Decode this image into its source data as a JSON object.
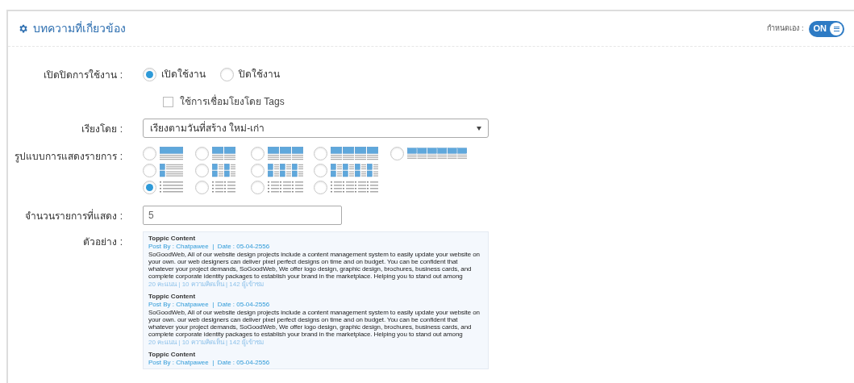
{
  "panel": {
    "title": "บทความที่เกี่ยวข้อง",
    "custom_label": "กำหนดเอง :",
    "custom_toggle": {
      "label": "ON",
      "on": true
    }
  },
  "form": {
    "enable": {
      "label": "เปิดปิดการใช้งาน :",
      "options": [
        {
          "label": "เปิดใช้งาน",
          "selected": true
        },
        {
          "label": "ปิดใช้งาน",
          "selected": false
        }
      ]
    },
    "tags_checkbox": {
      "label": "ใช้การเชื่อมโยงโดย Tags",
      "checked": false
    },
    "sort": {
      "label": "เรียงโดย :",
      "value": "เรียงตามวันที่สร้าง ใหม่-เก่า"
    },
    "layout": {
      "label": "รูปแบบการแสดงรายการ :",
      "rows": [
        [
          {
            "kind": "top",
            "selected": false
          },
          {
            "kind": "top",
            "selected": false
          },
          {
            "kind": "top",
            "selected": false
          },
          {
            "kind": "top",
            "selected": false
          },
          {
            "kind": "top",
            "selected": false
          }
        ],
        [
          {
            "kind": "side",
            "selected": false
          },
          {
            "kind": "side",
            "selected": false
          },
          {
            "kind": "side",
            "selected": false
          },
          {
            "kind": "side",
            "selected": false
          }
        ],
        [
          {
            "kind": "list",
            "selected": true
          },
          {
            "kind": "list",
            "selected": false
          },
          {
            "kind": "list",
            "selected": false
          },
          {
            "kind": "list",
            "selected": false
          }
        ]
      ]
    },
    "count": {
      "label": "จำนวนรายการที่แสดง :",
      "value": "5"
    },
    "preview": {
      "label": "ตัวอย่าง :",
      "items": [
        {
          "title": "Toppic Content",
          "meta": "Post By : Chatpawee  |  Date : 05-04-2556",
          "body": "SoGoodWeb, All of our website design projects include a content management system to easily update your website on your own. our web designers can deliver pixel perfect designs on time and on budget. You can be confident that whatever your project demands, SoGoodWeb, We offer logo design, graphic design, brochures, business cards, and complete corporate identity packages to establish your brand in the marketplace. Helping you to stand out among",
          "stats": "20 คะแนน | 10 ความคิดเห็น | 142 ผู้เข้าชม"
        },
        {
          "title": "Toppic Content",
          "meta": "Post By : Chatpawee  |  Date : 05-04-2556",
          "body": "SoGoodWeb, All of our website design projects include a content management system to easily update your website on your own. our web designers can deliver pixel perfect designs on time and on budget. You can be confident that whatever your project demands, SoGoodWeb, We offer logo design, graphic design, brochures, business cards, and complete corporate identity packages to establish your brand in the marketplace. Helping you to stand out among",
          "stats": "20 คะแนน | 10 ความคิดเห็น | 142 ผู้เข้าชม"
        },
        {
          "title": "Toppic Content",
          "meta": "Post By : Chatpawee  |  Date : 05-04-2556"
        }
      ]
    }
  }
}
